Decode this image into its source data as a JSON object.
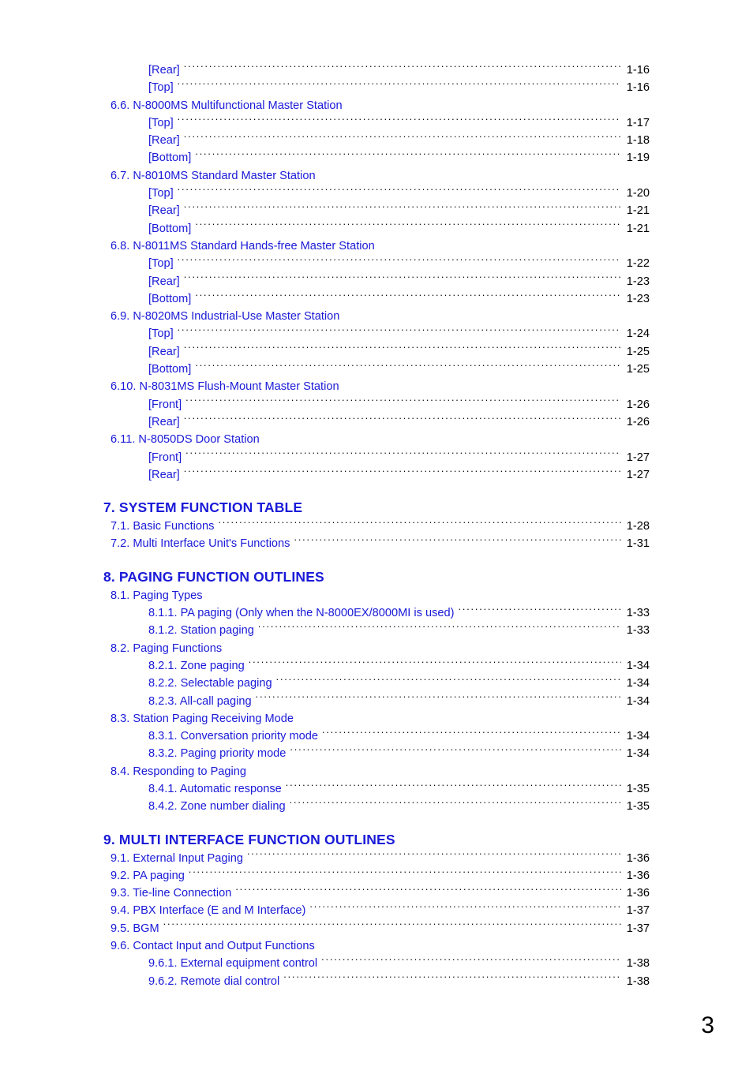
{
  "document": {
    "type": "table-of-contents",
    "page_label": "3",
    "text_color": "#1a1ad8",
    "leader_color": "#000000",
    "pagenum_color": "#000000"
  },
  "entries": [
    {
      "level": "sub2",
      "label": "[Rear]",
      "page": "1-16",
      "leader": true
    },
    {
      "level": "sub2",
      "label": "[Top]",
      "page": "1-16",
      "leader": true
    },
    {
      "level": "sub1",
      "label": "6.6. N-8000MS Multifunctional Master Station",
      "page": "",
      "leader": false
    },
    {
      "level": "sub2",
      "label": "[Top]",
      "page": "1-17",
      "leader": true
    },
    {
      "level": "sub2",
      "label": "[Rear]",
      "page": "1-18",
      "leader": true
    },
    {
      "level": "sub2",
      "label": "[Bottom]",
      "page": "1-19",
      "leader": true
    },
    {
      "level": "sub1",
      "label": "6.7. N-8010MS Standard Master Station",
      "page": "",
      "leader": false
    },
    {
      "level": "sub2",
      "label": "[Top]",
      "page": "1-20",
      "leader": true
    },
    {
      "level": "sub2",
      "label": "[Rear]",
      "page": "1-21",
      "leader": true
    },
    {
      "level": "sub2",
      "label": "[Bottom]",
      "page": "1-21",
      "leader": true
    },
    {
      "level": "sub1",
      "label": "6.8. N-8011MS Standard Hands-free Master Station",
      "page": "",
      "leader": false
    },
    {
      "level": "sub2",
      "label": "[Top]",
      "page": "1-22",
      "leader": true
    },
    {
      "level": "sub2",
      "label": "[Rear]",
      "page": "1-23",
      "leader": true
    },
    {
      "level": "sub2",
      "label": "[Bottom]",
      "page": "1-23",
      "leader": true
    },
    {
      "level": "sub1",
      "label": "6.9. N-8020MS Industrial-Use Master Station",
      "page": "",
      "leader": false
    },
    {
      "level": "sub2",
      "label": "[Top]",
      "page": "1-24",
      "leader": true
    },
    {
      "level": "sub2",
      "label": "[Rear]",
      "page": "1-25",
      "leader": true
    },
    {
      "level": "sub2",
      "label": "[Bottom]",
      "page": "1-25",
      "leader": true
    },
    {
      "level": "sub1",
      "label": "6.10. N-8031MS Flush-Mount Master Station",
      "page": "",
      "leader": false
    },
    {
      "level": "sub2",
      "label": "[Front]",
      "page": "1-26",
      "leader": true
    },
    {
      "level": "sub2",
      "label": "[Rear]",
      "page": "1-26",
      "leader": true
    },
    {
      "level": "sub1",
      "label": "6.11. N-8050DS Door Station",
      "page": "",
      "leader": false
    },
    {
      "level": "sub2",
      "label": "[Front]",
      "page": "1-27",
      "leader": true
    },
    {
      "level": "sub2",
      "label": "[Rear]",
      "page": "1-27",
      "leader": true
    },
    {
      "level": "gap",
      "label": "",
      "page": "",
      "leader": false
    },
    {
      "level": "major",
      "label": "7. SYSTEM FUNCTION TABLE",
      "page": "",
      "leader": false
    },
    {
      "level": "sub1",
      "label": "7.1. Basic Functions",
      "page": "1-28",
      "leader": true
    },
    {
      "level": "sub1",
      "label": "7.2. Multi Interface Unit's Functions",
      "page": "1-31",
      "leader": true
    },
    {
      "level": "gap",
      "label": "",
      "page": "",
      "leader": false
    },
    {
      "level": "major",
      "label": "8. PAGING FUNCTION OUTLINES",
      "page": "",
      "leader": false
    },
    {
      "level": "sub1",
      "label": "8.1. Paging Types",
      "page": "",
      "leader": false
    },
    {
      "level": "sub2",
      "label": "8.1.1. PA paging (Only when the N-8000EX/8000MI is used)",
      "page": "1-33",
      "leader": true
    },
    {
      "level": "sub2",
      "label": "8.1.2. Station paging",
      "page": "1-33",
      "leader": true
    },
    {
      "level": "sub1",
      "label": "8.2. Paging Functions",
      "page": "",
      "leader": false
    },
    {
      "level": "sub2",
      "label": "8.2.1. Zone paging",
      "page": "1-34",
      "leader": true
    },
    {
      "level": "sub2",
      "label": "8.2.2. Selectable paging",
      "page": "1-34",
      "leader": true
    },
    {
      "level": "sub2",
      "label": "8.2.3. All-call paging",
      "page": "1-34",
      "leader": true
    },
    {
      "level": "sub1",
      "label": "8.3. Station Paging Receiving Mode",
      "page": "",
      "leader": false
    },
    {
      "level": "sub2",
      "label": "8.3.1. Conversation priority mode",
      "page": "1-34",
      "leader": true
    },
    {
      "level": "sub2",
      "label": "8.3.2. Paging priority mode",
      "page": "1-34",
      "leader": true
    },
    {
      "level": "sub1",
      "label": "8.4. Responding to Paging",
      "page": "",
      "leader": false
    },
    {
      "level": "sub2",
      "label": "8.4.1. Automatic response",
      "page": "1-35",
      "leader": true
    },
    {
      "level": "sub2",
      "label": "8.4.2. Zone number dialing",
      "page": "1-35",
      "leader": true
    },
    {
      "level": "gap",
      "label": "",
      "page": "",
      "leader": false
    },
    {
      "level": "major",
      "label": "9. MULTI INTERFACE FUNCTION OUTLINES",
      "page": "",
      "leader": false
    },
    {
      "level": "sub1",
      "label": "9.1. External Input Paging",
      "page": "1-36",
      "leader": true
    },
    {
      "level": "sub1",
      "label": "9.2. PA paging",
      "page": "1-36",
      "leader": true
    },
    {
      "level": "sub1",
      "label": "9.3. Tie-line Connection",
      "page": "1-36",
      "leader": true
    },
    {
      "level": "sub1",
      "label": "9.4. PBX Interface (E and M Interface)",
      "page": "1-37",
      "leader": true
    },
    {
      "level": "sub1",
      "label": "9.5. BGM",
      "page": "1-37",
      "leader": true
    },
    {
      "level": "sub1",
      "label": "9.6. Contact Input and Output Functions",
      "page": "",
      "leader": false
    },
    {
      "level": "sub2",
      "label": "9.6.1. External equipment control",
      "page": "1-38",
      "leader": true
    },
    {
      "level": "sub2",
      "label": "9.6.2. Remote dial control",
      "page": "1-38",
      "leader": true
    }
  ]
}
